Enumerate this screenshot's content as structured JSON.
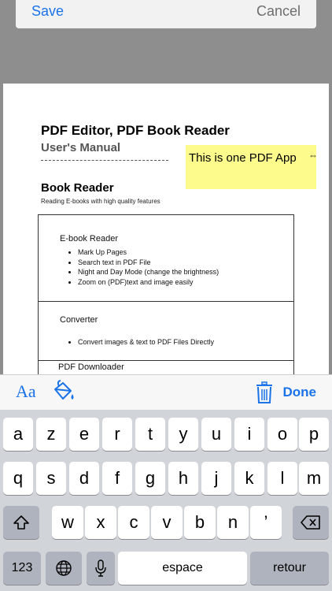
{
  "top_bar": {
    "save_label": "Save",
    "cancel_label": "Cancel"
  },
  "document": {
    "title": "PDF Editor, PDF Book Reader",
    "subtitle": "User's Manual",
    "note_text": "This is one PDF App",
    "section_title": "Book Reader",
    "section_desc": "Reading E-books with high quality features",
    "boxes": [
      {
        "title": "E-book Reader",
        "items": [
          "Mark Up Pages",
          "Search text in PDF File",
          "Night and Day Mode (change the brightness)",
          "Zoom on (PDF)text and image easily"
        ]
      },
      {
        "title": "Converter",
        "items": [
          "Convert images & text to PDF Files Directly"
        ]
      },
      {
        "title": "PDF Downloader",
        "items": []
      }
    ]
  },
  "toolbar": {
    "font_label": "Aa",
    "done_label": "Done",
    "font_icon": "font-icon",
    "fill_icon": "paint-bucket-icon",
    "trash_icon": "trash-icon",
    "accent": "#1a73e8"
  },
  "keyboard": {
    "row1": [
      "a",
      "z",
      "e",
      "r",
      "t",
      "y",
      "u",
      "i",
      "o",
      "p"
    ],
    "row2": [
      "q",
      "s",
      "d",
      "f",
      "g",
      "h",
      "j",
      "k",
      "l",
      "m"
    ],
    "row3": [
      "w",
      "x",
      "c",
      "v",
      "b",
      "n",
      "’"
    ],
    "numbers_label": "123",
    "space_label": "espace",
    "return_label": "retour"
  }
}
